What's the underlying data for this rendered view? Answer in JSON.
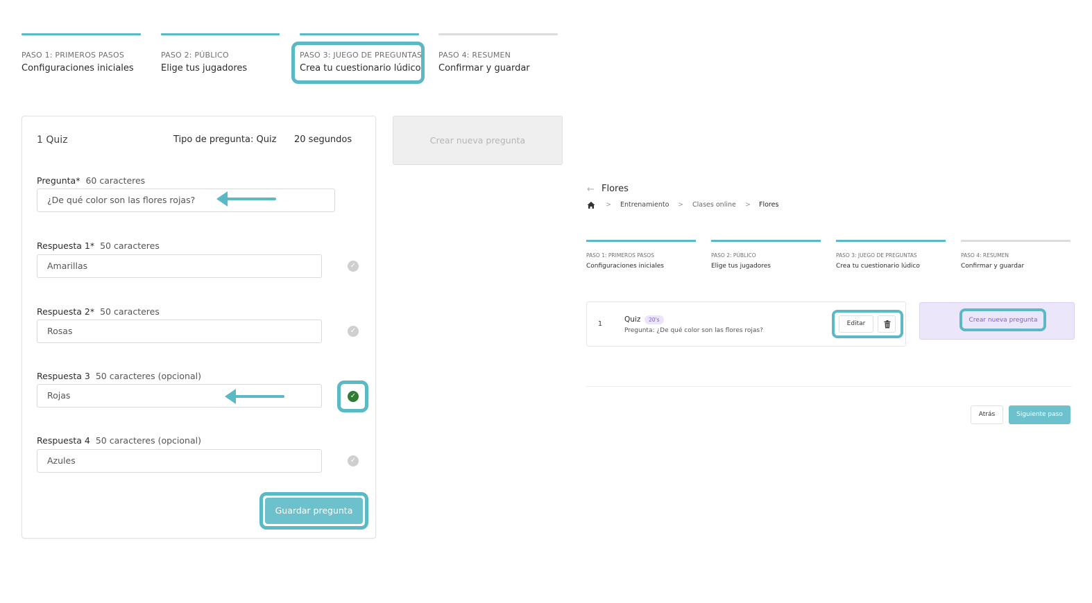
{
  "stepper": {
    "steps": [
      {
        "kicker": "PASO 1: PRIMEROS PASOS",
        "title": "Configuraciones iniciales"
      },
      {
        "kicker": "PASO 2: PÚBLICO",
        "title": "Elige tus jugadores"
      },
      {
        "kicker": "PASO 3: JUEGO DE PREGUNTAS",
        "title": "Crea tu cuestionario lúdico"
      },
      {
        "kicker": "PASO 4: RESUMEN",
        "title": "Confirmar y guardar"
      }
    ],
    "active_step": 3
  },
  "editor": {
    "question_number_type": "1 Quiz",
    "question_type": "Tipo de pregunta: Quiz",
    "duration": "20 segundos",
    "question": {
      "label": "Pregunta*",
      "limit": "60 caracteres",
      "value": "¿De qué color son las flores rojas?"
    },
    "answers": [
      {
        "label": "Respuesta 1*",
        "limit": "50 caracteres",
        "value": "Amarillas",
        "correct": false
      },
      {
        "label": "Respuesta 2*",
        "limit": "50 caracteres",
        "value": "Rosas",
        "correct": false
      },
      {
        "label": "Respuesta 3",
        "limit": "50 caracteres (opcional)",
        "value": "Rojas",
        "correct": true
      },
      {
        "label": "Respuesta 4",
        "limit": "50 caracteres (opcional)",
        "value": "Azules",
        "correct": false
      }
    ],
    "save_label": "Guardar pregunta",
    "new_question_label": "Crear nueva pregunta"
  },
  "summary": {
    "back_arrow": "←",
    "title": "Flores",
    "breadcrumb": [
      "Entrenamiento",
      "Clases online",
      "Flores"
    ],
    "breadcrumb_separator": ">",
    "question_row": {
      "number": "1",
      "type": "Quiz",
      "time_badge": "20's",
      "question_text": "Pregunta: ¿De qué color son las flores rojas?",
      "edit_label": "Editar"
    },
    "new_question_label": "Crear nueva pregunta",
    "back_label": "Atrás",
    "next_label": "Siguiente paso"
  },
  "colors": {
    "accent": "#5bb9c6",
    "correct": "#2e7d32",
    "purple": "#7b5cd6"
  }
}
